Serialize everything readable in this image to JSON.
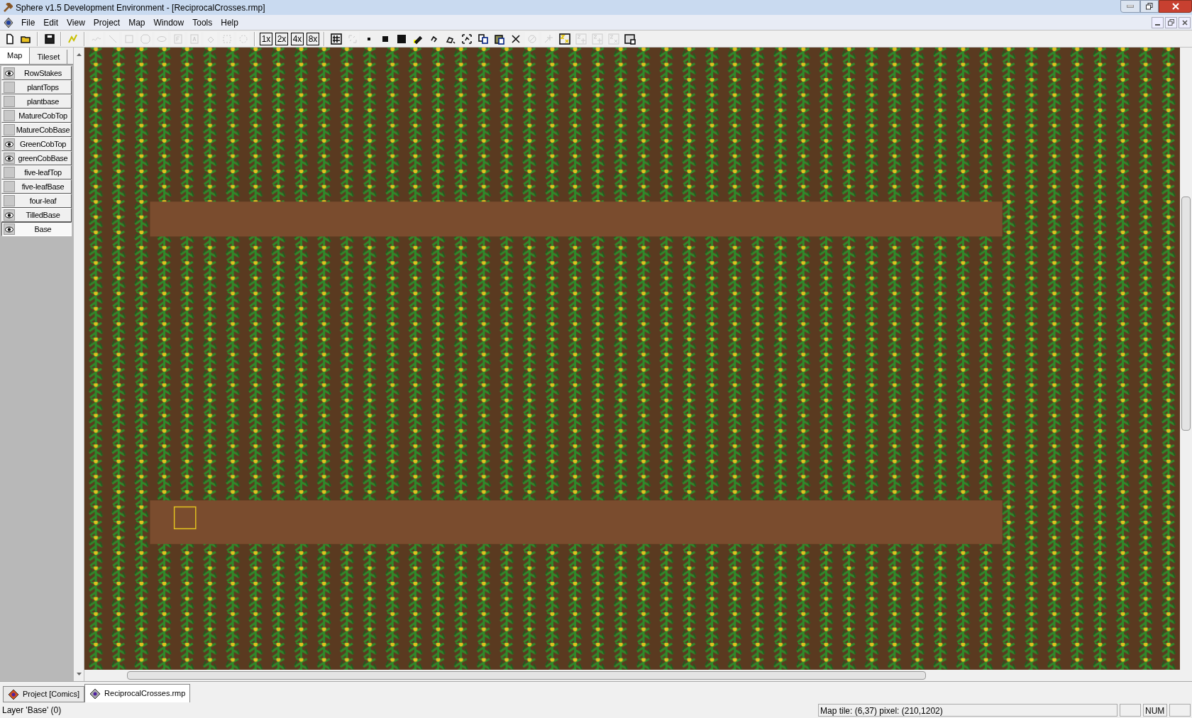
{
  "window": {
    "title": "Sphere v1.5 Development Environment - [ReciprocalCrosses.rmp]"
  },
  "menu": [
    "File",
    "Edit",
    "View",
    "Project",
    "Map",
    "Window",
    "Tools",
    "Help"
  ],
  "toolbar": [
    {
      "disabled": false
    },
    {
      "disabled": false
    },
    {
      "disabled": false
    },
    {
      "disabled": false
    },
    {
      "disabled": true
    },
    {
      "disabled": true
    },
    {
      "disabled": true
    },
    {
      "disabled": true
    },
    {
      "disabled": true
    },
    {
      "disabled": true
    },
    {
      "disabled": true
    },
    {
      "disabled": true
    },
    {
      "disabled": true
    },
    {
      "disabled": true
    },
    {
      "label": "1x",
      "disabled": false
    },
    {
      "label": "2x",
      "disabled": false
    },
    {
      "label": "4x",
      "disabled": false
    },
    {
      "label": "8x",
      "disabled": false
    },
    {
      "disabled": false
    },
    {
      "disabled": true
    },
    {
      "disabled": false
    },
    {
      "disabled": false
    },
    {
      "disabled": false
    },
    {
      "disabled": false
    },
    {
      "disabled": false
    },
    {
      "disabled": false
    },
    {
      "disabled": false
    },
    {
      "disabled": false
    },
    {
      "disabled": false
    },
    {
      "disabled": false
    },
    {
      "disabled": true
    },
    {
      "disabled": true
    },
    {
      "disabled": false
    },
    {
      "disabled": true
    },
    {
      "disabled": true
    },
    {
      "disabled": true
    },
    {
      "disabled": false
    }
  ],
  "panel_tabs": [
    {
      "label": "Map",
      "selected": true
    },
    {
      "label": "Tileset",
      "selected": false
    }
  ],
  "layers": [
    {
      "name": "RowStakes",
      "visible": true,
      "selected": false
    },
    {
      "name": "plantTops",
      "visible": false,
      "selected": false
    },
    {
      "name": "plantbase",
      "visible": false,
      "selected": false
    },
    {
      "name": "MatureCobTop",
      "visible": false,
      "selected": false
    },
    {
      "name": "MatureCobBase",
      "visible": false,
      "selected": false
    },
    {
      "name": "GreenCobTop",
      "visible": true,
      "selected": false
    },
    {
      "name": "greenCobBase",
      "visible": true,
      "selected": false
    },
    {
      "name": "five-leafTop",
      "visible": false,
      "selected": false
    },
    {
      "name": "five-leafBase",
      "visible": false,
      "selected": false
    },
    {
      "name": "four-leaf",
      "visible": false,
      "selected": false
    },
    {
      "name": "TilledBase",
      "visible": true,
      "selected": false
    },
    {
      "name": "Base",
      "visible": true,
      "selected": true
    }
  ],
  "document_tabs": [
    {
      "label": "Project [Comics]",
      "selected": false
    },
    {
      "label": "ReciprocalCrosses.rmp",
      "selected": true
    }
  ],
  "status_bar": {
    "left": "Layer 'Base' (0)",
    "position": "Map tile: (6,37) pixel: (210,1202)",
    "num": "NUM"
  }
}
